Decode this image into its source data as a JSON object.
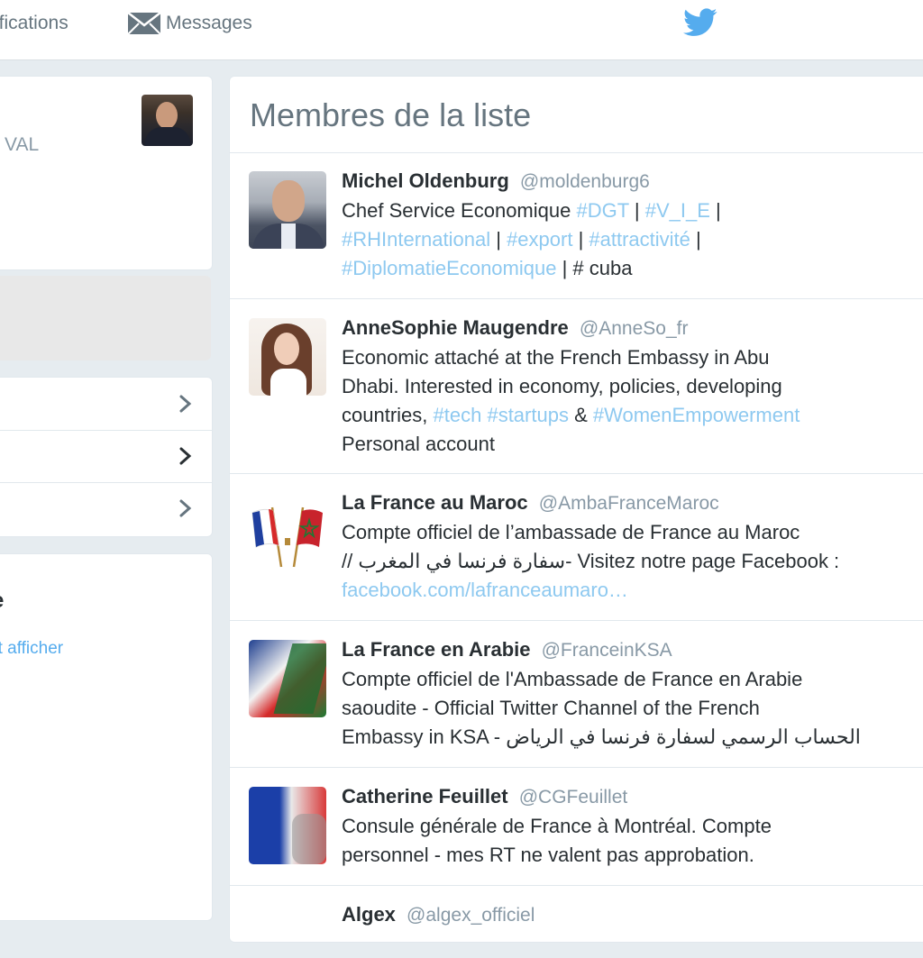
{
  "nav": {
    "notifications_label": "ifications",
    "messages_label": "Messages"
  },
  "left": {
    "profile_name_fragment": "VAL",
    "trends_title_fragment": "e",
    "trends_link_fragment": "ut afficher"
  },
  "panel": {
    "title": "Membres de la liste"
  },
  "members": [
    {
      "name": "Michel Oldenburg",
      "handle": "@moldenburg6",
      "bio_lines": [
        [
          {
            "t": "Chef Service Economique ",
            "tag": false
          },
          {
            "t": "#DGT",
            "tag": true
          },
          {
            "t": " | ",
            "tag": false
          },
          {
            "t": "#V_I_E",
            "tag": true
          },
          {
            "t": " |",
            "tag": false
          }
        ],
        [
          {
            "t": "#RHInternational",
            "tag": true
          },
          {
            "t": " | ",
            "tag": false
          },
          {
            "t": "#export",
            "tag": true
          },
          {
            "t": " | ",
            "tag": false
          },
          {
            "t": "#attractivité",
            "tag": true
          },
          {
            "t": " |",
            "tag": false
          }
        ],
        [
          {
            "t": "#DiplomatieEconomique",
            "tag": true
          },
          {
            "t": " | # cuba",
            "tag": false
          }
        ]
      ]
    },
    {
      "name": "AnneSophie Maugendre",
      "handle": "@AnneSo_fr",
      "bio_lines": [
        [
          {
            "t": "Economic attaché at the French Embassy in Abu",
            "tag": false
          }
        ],
        [
          {
            "t": "Dhabi. Interested in economy, policies, developing",
            "tag": false
          }
        ],
        [
          {
            "t": "countries, ",
            "tag": false
          },
          {
            "t": "#tech",
            "tag": true
          },
          {
            "t": " ",
            "tag": false
          },
          {
            "t": "#startups",
            "tag": true
          },
          {
            "t": " & ",
            "tag": false
          },
          {
            "t": "#WomenEmpowerment",
            "tag": true
          }
        ],
        [
          {
            "t": "Personal account",
            "tag": false
          }
        ]
      ]
    },
    {
      "name": "La France au Maroc",
      "handle": "@AmbaFranceMaroc",
      "bio_lines": [
        [
          {
            "t": "Compte officiel de l’ambassade de France au Maroc",
            "tag": false
          }
        ],
        [
          {
            "t": "// سفارة فرنسا في المغرب- Visitez notre page Facebook :",
            "tag": false
          }
        ],
        [
          {
            "t": "facebook.com/lafranceaumaro…",
            "tag": true
          }
        ]
      ]
    },
    {
      "name": "La France en Arabie",
      "handle": "@FranceinKSA",
      "bio_lines": [
        [
          {
            "t": "Compte officiel de l'Ambassade de France en Arabie",
            "tag": false
          }
        ],
        [
          {
            "t": "saoudite - Official Twitter Channel of the French",
            "tag": false
          }
        ],
        [
          {
            "t": "Embassy in KSA - الحساب الرسمي لسفارة فرنسا في الرياض",
            "tag": false
          }
        ]
      ]
    },
    {
      "name": "Catherine Feuillet",
      "handle": "@CGFeuillet",
      "bio_lines": [
        [
          {
            "t": "Consule générale de France à Montréal. Compte",
            "tag": false
          }
        ],
        [
          {
            "t": "personnel - mes RT ne valent pas approbation.",
            "tag": false
          }
        ]
      ]
    },
    {
      "name": "Algex",
      "handle": "@algex_officiel",
      "bio_lines": []
    }
  ],
  "colors": {
    "accent": "#55acee",
    "hashtag": "#8ec9f0",
    "muted": "#8899a6",
    "text": "#292f33"
  },
  "icons": {
    "messages": "envelope-icon",
    "brand": "twitter-bird-icon",
    "menu_chevron": "chevron-right-icon"
  }
}
